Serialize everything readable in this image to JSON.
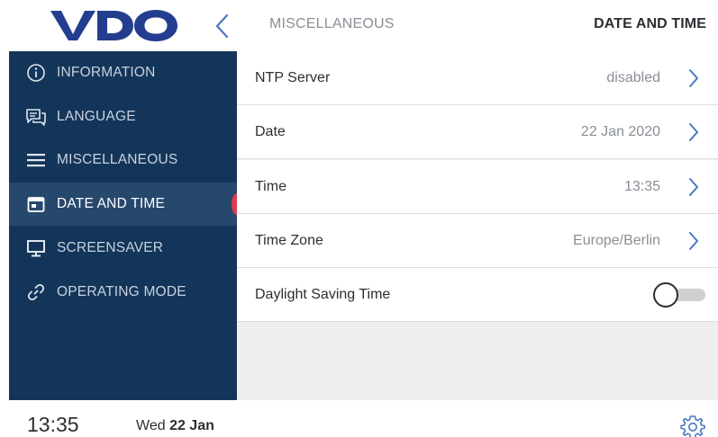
{
  "header": {
    "logo_text": "VDO",
    "breadcrumb": "MISCELLANEOUS",
    "title": "DATE AND TIME",
    "back_icon": "chevron-left-icon"
  },
  "sidebar": {
    "items": [
      {
        "label": "INFORMATION",
        "icon": "info-icon",
        "active": false
      },
      {
        "label": "LANGUAGE",
        "icon": "speech-bubbles-icon",
        "active": false
      },
      {
        "label": "MISCELLANEOUS",
        "icon": "menu-icon",
        "active": false
      },
      {
        "label": "DATE AND TIME",
        "icon": "calendar-icon",
        "active": true
      },
      {
        "label": "SCREENSAVER",
        "icon": "monitor-icon",
        "active": false
      },
      {
        "label": "OPERATING MODE",
        "icon": "link-icon",
        "active": false
      }
    ]
  },
  "settings_list": [
    {
      "label": "NTP Server",
      "value": "disabled",
      "type": "link"
    },
    {
      "label": "Date",
      "value": "22 Jan 2020",
      "type": "link"
    },
    {
      "label": "Time",
      "value": "13:35",
      "type": "link"
    },
    {
      "label": "Time Zone",
      "value": "Europe/Berlin",
      "type": "link"
    },
    {
      "label": "Daylight Saving Time",
      "value": "off",
      "type": "toggle"
    }
  ],
  "footer": {
    "time": "13:35",
    "weekday": "Wed",
    "date": "22 Jan",
    "settings_icon": "gear-icon"
  },
  "colors": {
    "brand_blue": "#233e8f",
    "sidebar_bg": "#14355a",
    "sidebar_active": "#27486d",
    "accent_red": "#e03a4d",
    "chevron_blue": "#4a78c2"
  }
}
